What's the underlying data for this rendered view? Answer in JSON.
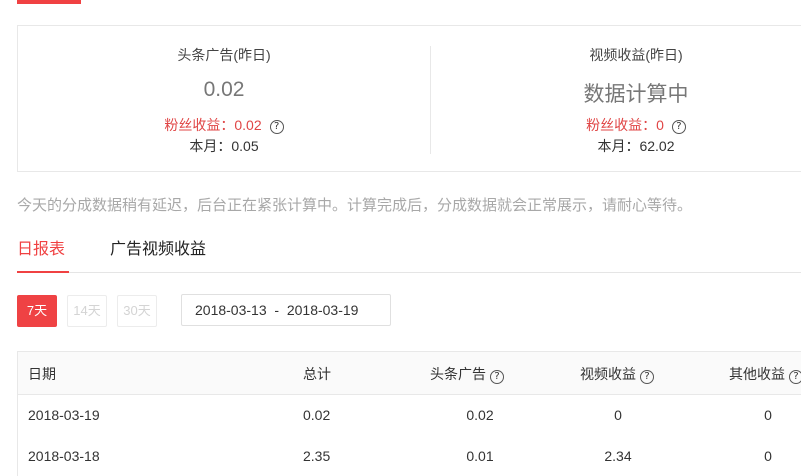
{
  "summary": {
    "toutiao_ad": {
      "title": "头条广告(昨日)",
      "value": "0.02",
      "fans_income": "粉丝收益：0.02",
      "month": "本月：0.05"
    },
    "video_income": {
      "title": "视频收益(昨日)",
      "value": "数据计算中",
      "fans_income": "粉丝收益：0",
      "month": "本月：62.02"
    },
    "help_glyph": "?"
  },
  "notice": "今天的分成数据稍有延迟，后台正在紧张计算中。计算完成后，分成数据就会正常展示，请耐心等待。",
  "tabs": [
    {
      "label": "日报表",
      "active": true
    },
    {
      "label": "广告视频收益",
      "active": false
    }
  ],
  "filters": {
    "ranges": [
      {
        "label": "7天",
        "active": true
      },
      {
        "label": "14天",
        "active": false
      },
      {
        "label": "30天",
        "active": false
      }
    ],
    "date_range": "2018-03-13  -  2018-03-19"
  },
  "table": {
    "columns": {
      "date": "日期",
      "total": "总计",
      "toutiao_ad": "头条广告",
      "video_income": "视频收益",
      "other_income": "其他收益"
    },
    "rows": [
      {
        "date": "2018-03-19",
        "total": "0.02",
        "toutiao_ad": "0.02",
        "video_income": "0",
        "other_income": "0"
      },
      {
        "date": "2018-03-18",
        "total": "2.35",
        "toutiao_ad": "0.01",
        "video_income": "2.34",
        "other_income": "0"
      }
    ]
  },
  "colors": {
    "accent": "#f04142",
    "muted_text": "#a8a8a8"
  }
}
